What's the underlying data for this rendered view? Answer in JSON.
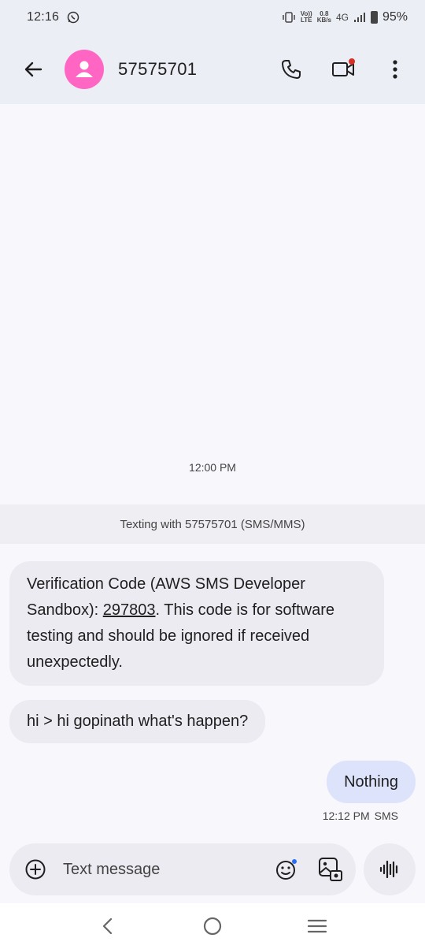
{
  "status_bar": {
    "time": "12:16",
    "volte_top": "Vo))",
    "volte_bottom": "LTE",
    "speed_value": "0.8",
    "speed_unit": "KB/s",
    "network": "4G",
    "battery": "95%"
  },
  "app_bar": {
    "contact": "57575701",
    "icons": [
      "back-arrow-icon",
      "avatar-person-icon",
      "phone-icon",
      "video-call-icon",
      "more-vert-icon"
    ],
    "accent_avatar": "#ff66c4",
    "notification_dot": "#d93025"
  },
  "conversation": {
    "timestamp": "12:00 PM",
    "banner": "Texting with 57575701 (SMS/MMS)",
    "messages": [
      {
        "direction": "incoming",
        "text_before": "Verification Code (AWS SMS Developer Sandbox): ",
        "code": "297803",
        "text_after": ". This code is for software testing and should be ignored if received unexpectedly."
      },
      {
        "direction": "incoming",
        "text": "hi > hi gopinath what's happen?"
      },
      {
        "direction": "outgoing",
        "text": "Nothing",
        "time": "12:12 PM",
        "type": "SMS"
      }
    ]
  },
  "composer": {
    "placeholder": "Text message",
    "icons": [
      "add-circle-icon",
      "emoji-icon",
      "gallery-icon",
      "voice-waveform-icon"
    ]
  },
  "nav_bar": {
    "icons": [
      "nav-back-icon",
      "nav-home-icon",
      "nav-recents-icon"
    ]
  },
  "colors": {
    "header_bg": "#eceef5",
    "incoming_bubble": "#ecebf1",
    "outgoing_bubble": "#dde3fb"
  }
}
